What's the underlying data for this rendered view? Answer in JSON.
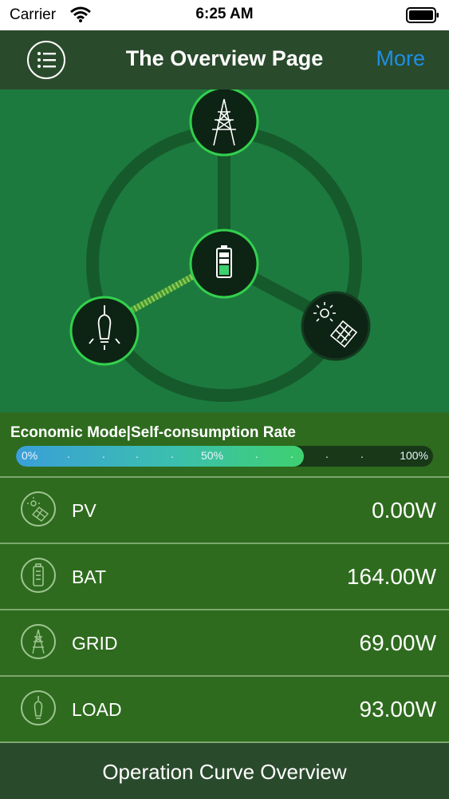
{
  "status_bar": {
    "carrier": "Carrier",
    "time": "6:25 AM"
  },
  "nav": {
    "title": "The Overview Page",
    "more_label": "More"
  },
  "mode": {
    "label": "Economic Mode|Self-consumption Rate",
    "rate_percent": 69,
    "tick_start": "0%",
    "tick_mid": "50%",
    "tick_end": "100%"
  },
  "rows": [
    {
      "label": "PV",
      "value": "0.00W",
      "icon": "solar-panel-icon"
    },
    {
      "label": "BAT",
      "value": "164.00W",
      "icon": "battery-icon"
    },
    {
      "label": "GRID",
      "value": "69.00W",
      "icon": "power-tower-icon"
    },
    {
      "label": "LOAD",
      "value": "93.00W",
      "icon": "light-bulb-icon"
    }
  ],
  "bottom_button": {
    "label": "Operation Curve Overview"
  },
  "colors": {
    "accent_blue": "#1e8fe6",
    "active_green": "#3fd070",
    "bar_bg": "#2a4a2c",
    "diagram_bg": "#1d7a3e"
  }
}
